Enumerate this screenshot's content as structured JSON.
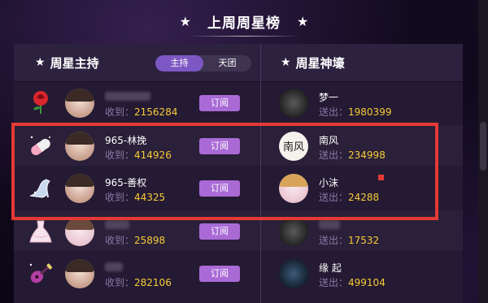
{
  "header": {
    "title": "上周周星榜",
    "star_icon": "star-icon"
  },
  "left_panel": {
    "title": "周星主持",
    "tabs": [
      {
        "label": "主持",
        "active": true
      },
      {
        "label": "天团",
        "active": false
      }
    ],
    "rows": [
      {
        "gift": "rose-icon",
        "name": "",
        "stat_label": "收到：",
        "stat_value": "2156284",
        "button": "订阅"
      },
      {
        "gift": "pill-icon",
        "name": "965-林挽",
        "stat_label": "收到：",
        "stat_value": "414926",
        "button": "订阅"
      },
      {
        "gift": "crystal-shoe-icon",
        "name": "965-善权",
        "stat_label": "收到：",
        "stat_value": "44325",
        "button": "订阅"
      },
      {
        "gift": "dress-icon",
        "name": "",
        "stat_label": "收到：",
        "stat_value": "25898",
        "button": "订阅"
      },
      {
        "gift": "guitar-icon",
        "name": "",
        "stat_label": "收到：",
        "stat_value": "282106",
        "button": "订阅"
      }
    ]
  },
  "right_panel": {
    "title": "周星神壕",
    "rows": [
      {
        "name": "梦一",
        "stat_label": "送出：",
        "stat_value": "1980399"
      },
      {
        "name": "南风",
        "stat_label": "送出：",
        "stat_value": "234998",
        "avatar_text": "南风"
      },
      {
        "name": "小沫",
        "stat_label": "送出：",
        "stat_value": "24288"
      },
      {
        "name": "",
        "stat_label": "送出：",
        "stat_value": "17532"
      },
      {
        "name": "缘 起",
        "stat_label": "送出：",
        "stat_value": "499104"
      }
    ]
  },
  "colors": {
    "highlight": "#e53935",
    "button": "#a96ad6",
    "value": "#f7cb37",
    "label": "#8a78a8"
  }
}
